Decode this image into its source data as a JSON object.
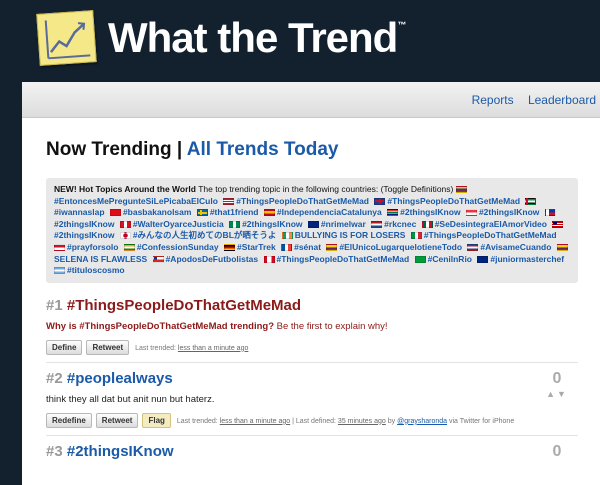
{
  "brand": {
    "name": "What the Trend",
    "tm": "™"
  },
  "nav": {
    "reports": "Reports",
    "leaderboard": "Leaderboard"
  },
  "heading": {
    "now": "Now Trending",
    "sep": "|",
    "all": "All Trends Today"
  },
  "hot": {
    "lead": "NEW! Hot Topics Around the World",
    "desc": "The top trending topic in the following countries:",
    "toggle": "(Toggle Definitions)",
    "items": [
      {
        "flag": "venezuela",
        "tag": "#EntoncesMePregunteSiLePicabaElCulo"
      },
      {
        "flag": "usa",
        "tag": "#ThingsPeopleDoThatGetMeMad"
      },
      {
        "flag": "uk",
        "tag": "#ThingsPeopleDoThatGetMeMad"
      },
      {
        "flag": "uae",
        "tag": "#iwannaslap"
      },
      {
        "flag": "turkey",
        "tag": "#basbakanolsam"
      },
      {
        "flag": "sweden",
        "tag": "#that1friend"
      },
      {
        "flag": "spain",
        "tag": "#IndependenciaCatalunya"
      },
      {
        "flag": "southafrica",
        "tag": "#2thingsIKnow"
      },
      {
        "flag": "singapore",
        "tag": "#2thingsIKnow"
      },
      {
        "flag": "philippines",
        "tag": "#2thingsIKnow"
      },
      {
        "flag": "peru",
        "tag": "#WalterOyarceJusticia"
      },
      {
        "flag": "nigeria",
        "tag": "#2thingsIKnow"
      },
      {
        "flag": "nz",
        "tag": "#nrimelwar"
      },
      {
        "flag": "netherlands",
        "tag": "#rkcnec"
      },
      {
        "flag": "mexico",
        "tag": "#SeDesintegraElAmorVideo"
      },
      {
        "flag": "malaysia",
        "tag": "#2thingsIKnow"
      },
      {
        "flag": "japan",
        "tag": "#みんなの人生初めてのBLが晒そうよ"
      },
      {
        "flag": "ireland",
        "tag": "BULLYING IS FOR LOSERS"
      },
      {
        "flag": "italy",
        "tag": "#ThingsPeopleDoThatGetMeMad"
      },
      {
        "flag": "indonesia",
        "tag": "#prayforsolo"
      },
      {
        "flag": "india",
        "tag": "#ConfessionSunday"
      },
      {
        "flag": "germany",
        "tag": "#StarTrek"
      },
      {
        "flag": "france",
        "tag": "#sénat"
      },
      {
        "flag": "colombia",
        "tag": "#ElUnicoLugarquelotieneTodo"
      },
      {
        "flag": "netherlands",
        "tag": "#AvisameCuando"
      },
      {
        "flag": "colombia",
        "tag": "SELENA IS FLAWLESS"
      },
      {
        "flag": "chile",
        "tag": "#ApodosDeFutbolistas"
      },
      {
        "flag": "canada",
        "tag": "#ThingsPeopleDoThatGetMeMad"
      },
      {
        "flag": "brazil",
        "tag": "#CenilnRio"
      },
      {
        "flag": "australia",
        "tag": "#juniormasterchef"
      },
      {
        "flag": "argentina",
        "tag": "#tituloscosmo"
      }
    ]
  },
  "trends": [
    {
      "num": "#1",
      "name": "#ThingsPeopleDoThatGetMeMad",
      "why": "Why is #ThingsPeopleDoThatGetMeMad trending?",
      "why_tail": "Be the first to explain why!",
      "buttons": [
        "Define",
        "Retweet"
      ],
      "last": "Last trended:",
      "last_val": "less than a minute ago"
    },
    {
      "num": "#2",
      "name": "#peoplealways",
      "votes": "0",
      "desc": "think they all dat but anit nun but haterz.",
      "buttons": [
        "Redefine",
        "Retweet",
        "Flag"
      ],
      "last": "Last trended:",
      "last_val": "less than a minute ago",
      "defined": "| Last defined:",
      "defined_val": "35 minutes ago",
      "by": "by",
      "author": "@graysharonda",
      "via": "via Twitter for iPhone"
    },
    {
      "num": "#3",
      "name": "#2thingsIKnow",
      "votes": "0"
    }
  ],
  "colors": {
    "bg": "#13212f",
    "link": "#1a5aa8",
    "trend": "#8b1a1a",
    "logo": "#f4e889"
  }
}
